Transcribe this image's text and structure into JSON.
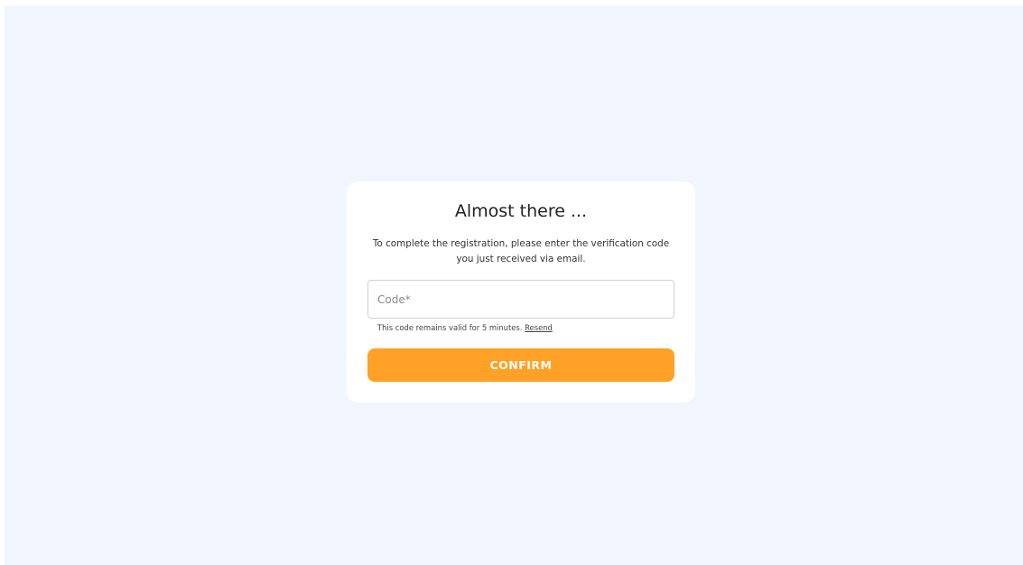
{
  "page": {
    "background_color": "#f1f5fd"
  },
  "card": {
    "title": "Almost there ...",
    "description": "To complete the registration, please enter the verification code you just received via email.",
    "code_field": {
      "placeholder": "Code*",
      "value": ""
    },
    "hint": {
      "text": "This code remains valid for 5 minutes.",
      "resend_label": "Resend"
    },
    "confirm_label": "CONFIRM",
    "accent_color": "#ffa126"
  }
}
